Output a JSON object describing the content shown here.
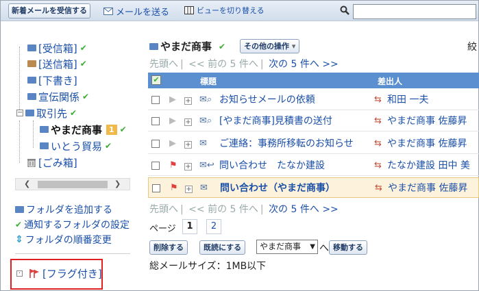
{
  "toolbar": {
    "receive_label": "新着メールを受信する",
    "send_label": "メールを送る",
    "view_label": "ビューを切り替える",
    "search_placeholder": ""
  },
  "tree": {
    "inbox": "[受信箱]",
    "sent": "[送信箱]",
    "drafts": "[下書き]",
    "promo": "宣伝関係",
    "clients": "取引先",
    "yamada": "やまだ商事",
    "yamada_badge": "1",
    "itou": "いとう貿易",
    "trash": "[ごみ箱]"
  },
  "side_links": {
    "add_folder": "フォルダを追加する",
    "notify_settings": "通知するフォルダの設定",
    "reorder": "フォルダの順番変更"
  },
  "flagged": "[フラグ付き]",
  "main": {
    "folder_title": "やまだ商事",
    "other_ops": "その他の操作",
    "narrow_label": "絞",
    "pager": {
      "first": "先頭へ",
      "prev": "<< 前の 5 件へ",
      "next": "次の 5 件へ >>"
    },
    "columns": {
      "subject": "標題",
      "sender": "差出人"
    },
    "rows": [
      {
        "subject": "お知らせメールの依頼",
        "sender": "和田 一夫"
      },
      {
        "subject": "[やまだ商事]見積書の送付",
        "sender": "やまだ商事 佐藤昇"
      },
      {
        "subject": "ご連絡：事務所移転のお知らせ",
        "sender": "やまだ商事 佐藤昇"
      },
      {
        "subject": "問い合わせ　たなか建設",
        "sender": "たなか建設 田中 美"
      },
      {
        "subject": "問い合わせ（やまだ商事）",
        "sender": "やまだ商事 佐藤昇"
      }
    ],
    "page_label": "ページ",
    "pages": [
      "1",
      "2"
    ],
    "delete_label": "削除する",
    "mark_read_label": "既読にする",
    "move_select": "やまだ商事",
    "to_label": "へ",
    "move_label": "移動する",
    "total_size": "総メールサイズ：1MB以下"
  },
  "colors": {
    "header_blue": "#5b8fcf",
    "link": "#1a4fa8",
    "flag_red": "#e04040",
    "check_green": "#3cae33"
  }
}
